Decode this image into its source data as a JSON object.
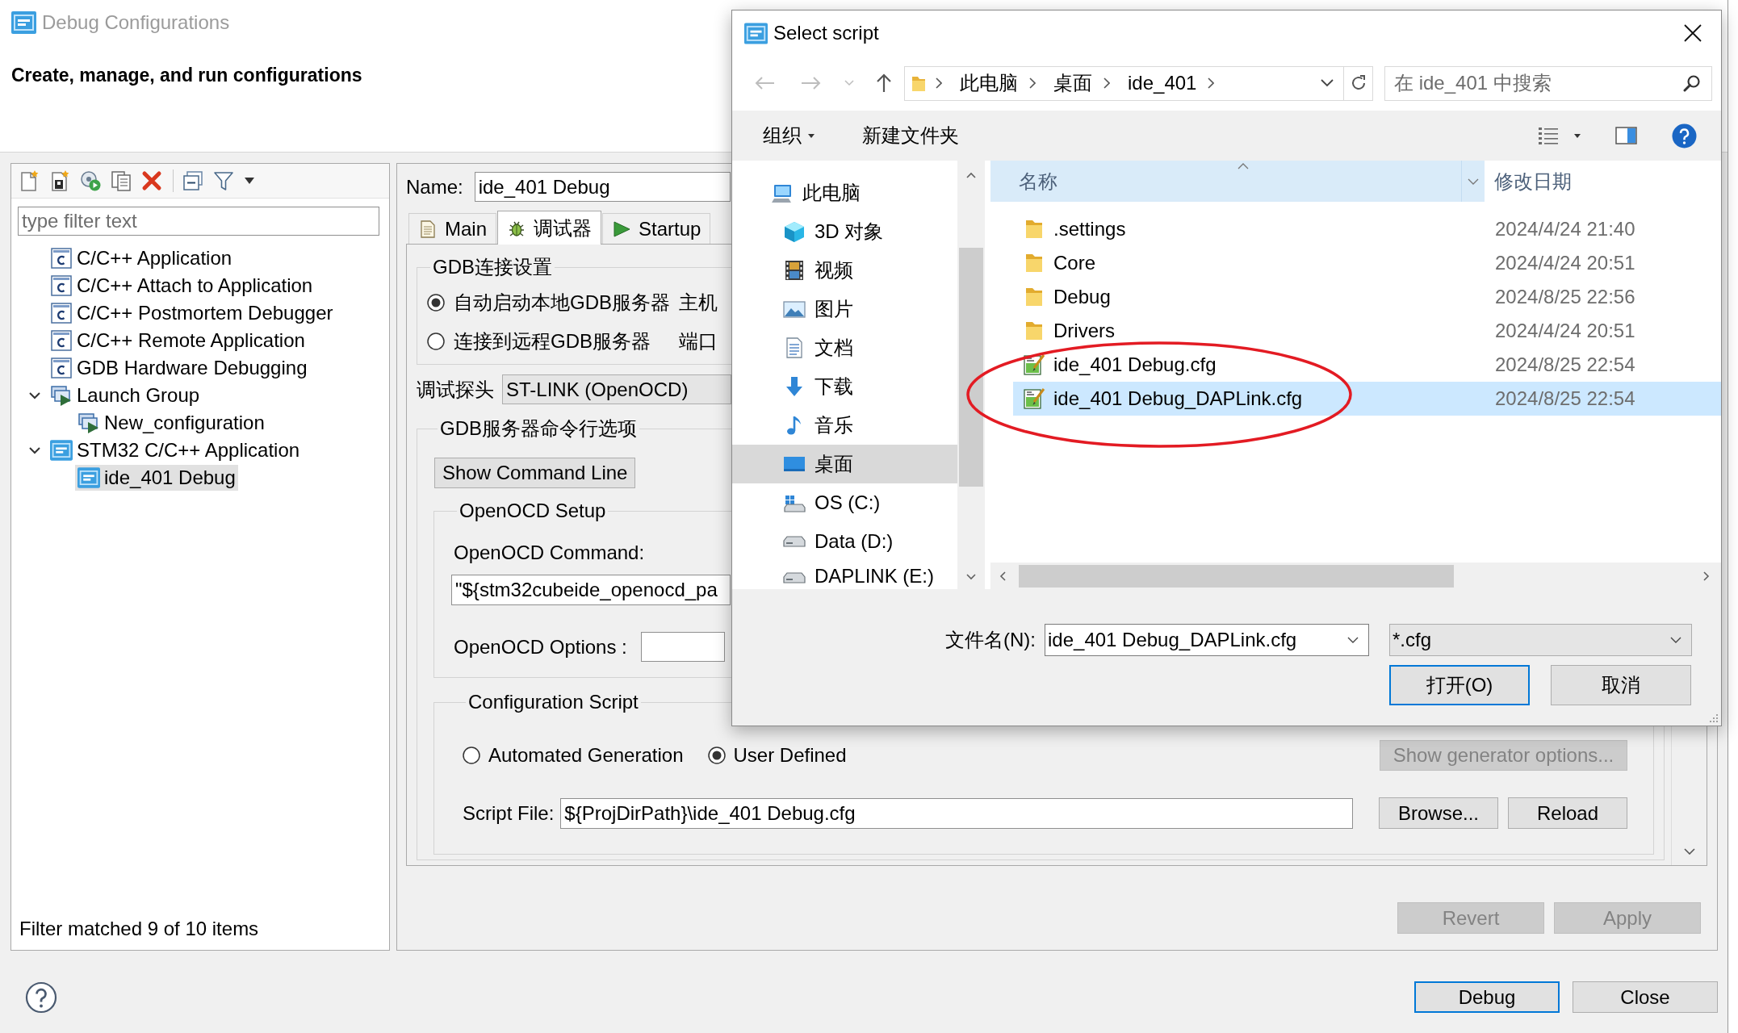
{
  "main_window": {
    "title": "Debug Configurations",
    "heading": "Create, manage, and run configurations",
    "config_list": {
      "filter": {
        "placeholder": "type filter text"
      },
      "tree": [
        {
          "label": "C/C++ Application",
          "kind": "c",
          "selected": false
        },
        {
          "label": "C/C++ Attach to Application",
          "kind": "c",
          "selected": false
        },
        {
          "label": "C/C++ Postmortem Debugger",
          "kind": "c",
          "selected": false
        },
        {
          "label": "C/C++ Remote Application",
          "kind": "c",
          "selected": false
        },
        {
          "label": "GDB Hardware Debugging",
          "kind": "c",
          "selected": false
        },
        {
          "label": "Launch Group",
          "kind": "group",
          "selected": false,
          "expanded": true,
          "children": [
            {
              "label": "New_configuration",
              "kind": "group",
              "selected": false
            }
          ]
        },
        {
          "label": "STM32 C/C++ Application",
          "kind": "ide",
          "selected": false,
          "expanded": true,
          "children": [
            {
              "label": "ide_401 Debug",
              "kind": "ide",
              "selected": true
            }
          ]
        }
      ],
      "status": "Filter matched 9 of 10 items"
    },
    "editor": {
      "name": {
        "label": "Name:",
        "value": "ide_401 Debug"
      },
      "tabs": [
        {
          "label": "Main",
          "kind": "main",
          "selected": false
        },
        {
          "label": "调试器",
          "kind": "debugger",
          "selected": true
        },
        {
          "label": "Startup",
          "kind": "startup",
          "selected": false
        }
      ],
      "gdb_connection": {
        "title": "GDB连接设置",
        "options": [
          {
            "label": "自动启动本地GDB服务器",
            "selected": true,
            "field_label": "主机"
          },
          {
            "label": "连接到远程GDB服务器",
            "selected": false,
            "field_label": "端口"
          }
        ]
      },
      "probe": {
        "label": "调试探头",
        "value": "ST-LINK (OpenOCD)"
      },
      "server_options": {
        "title": "GDB服务器命令行选项",
        "show_command_line": "Show Command Line",
        "openocd_setup": {
          "title": "OpenOCD Setup",
          "command_label": "OpenOCD Command:",
          "command_value": "\"${stm32cubeide_openocd_pa",
          "options_label": "OpenOCD Options :"
        },
        "config_script": {
          "title": "Configuration Script",
          "modes": [
            {
              "label": "Automated Generation",
              "selected": false
            },
            {
              "label": "User Defined",
              "selected": true
            }
          ],
          "generator_button": {
            "label": "Show generator options...",
            "disabled": true
          },
          "script_file": {
            "label": "Script File:",
            "value": "${ProjDirPath}\\ide_401 Debug.cfg"
          },
          "buttons": [
            "Browse...",
            "Reload"
          ]
        }
      },
      "buttons": [
        {
          "label": "Revert",
          "disabled": true
        },
        {
          "label": "Apply",
          "disabled": true
        }
      ]
    },
    "buttons": [
      {
        "label": "Debug",
        "focused": true
      },
      {
        "label": "Close",
        "focused": false
      }
    ]
  },
  "dialog": {
    "title": "Select script",
    "path": [
      "此电脑",
      "桌面",
      "ide_401"
    ],
    "search": {
      "placeholder": "在 ide_401 中搜索"
    },
    "commands": [
      {
        "label": "组织",
        "has_menu": true
      },
      {
        "label": "新建文件夹",
        "has_menu": false
      }
    ],
    "nav": [
      {
        "label": "此电脑",
        "kind": "pc",
        "selected": false,
        "children": [
          {
            "label": "3D 对象",
            "kind": "objects",
            "selected": false
          },
          {
            "label": "视频",
            "kind": "videos",
            "selected": false
          },
          {
            "label": "图片",
            "kind": "pictures",
            "selected": false
          },
          {
            "label": "文档",
            "kind": "documents",
            "selected": false
          },
          {
            "label": "下载",
            "kind": "downloads",
            "selected": false
          },
          {
            "label": "音乐",
            "kind": "music",
            "selected": false
          },
          {
            "label": "桌面",
            "kind": "desktop",
            "selected": true
          },
          {
            "label": "OS (C:)",
            "kind": "system-drive",
            "selected": false
          },
          {
            "label": "Data (D:)",
            "kind": "drive",
            "selected": false
          },
          {
            "label": "DAPLINK (E:)",
            "kind": "drive",
            "selected": false
          }
        ]
      }
    ],
    "columns": [
      {
        "label": "名称",
        "sorted": true
      },
      {
        "label": "修改日期",
        "sorted": false
      }
    ],
    "files": [
      {
        "name": ".settings",
        "kind": "folder",
        "modified": "2024/4/24 21:40",
        "selected": false
      },
      {
        "name": "Core",
        "kind": "folder",
        "modified": "2024/4/24 20:51",
        "selected": false
      },
      {
        "name": "Debug",
        "kind": "folder",
        "modified": "2024/8/25 22:56",
        "selected": false
      },
      {
        "name": "Drivers",
        "kind": "folder",
        "modified": "2024/4/24 20:51",
        "selected": false
      },
      {
        "name": "ide_401 Debug.cfg",
        "kind": "cfg",
        "modified": "2024/8/25 22:54",
        "selected": false
      },
      {
        "name": "ide_401 Debug_DAPLink.cfg",
        "kind": "cfg",
        "modified": "2024/8/25 22:54",
        "selected": true
      }
    ],
    "file_name": {
      "label": "文件名(N):",
      "value": "ide_401 Debug_DAPLink.cfg"
    },
    "file_type": {
      "value": "*.cfg"
    },
    "buttons": [
      {
        "label": "打开(O)",
        "focused": true
      },
      {
        "label": "取消",
        "focused": false
      }
    ]
  }
}
